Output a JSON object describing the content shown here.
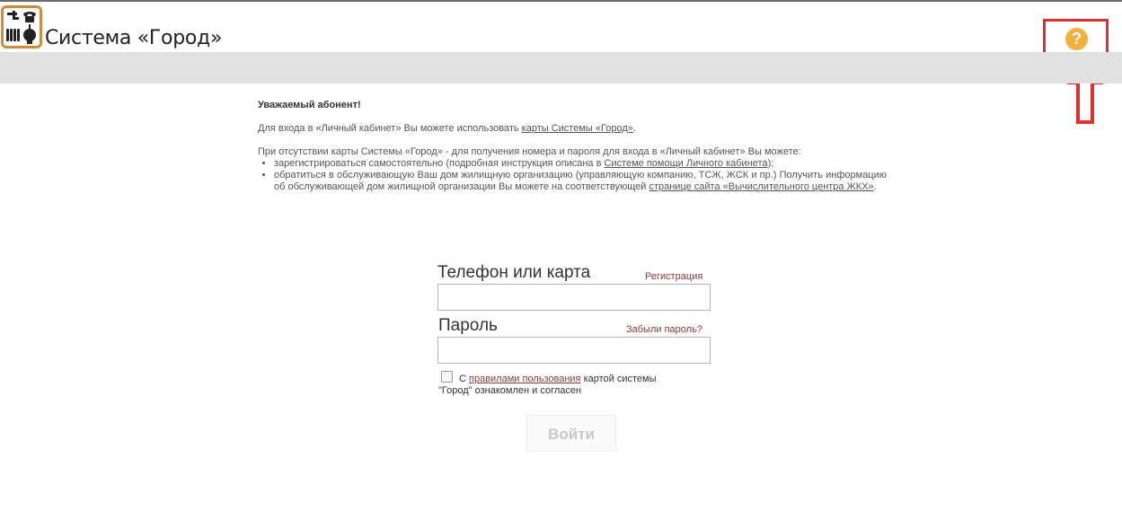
{
  "header": {
    "brand": "Система «Город»",
    "help_label": "?",
    "accent": "#d08a3a",
    "help_color": "#f3b03e",
    "highlight_color": "#e12f2f"
  },
  "intro": {
    "heading": "Уважаемый абонент!",
    "p1_text": "Для входа в «Личный кабинет» Вы можете использовать ",
    "p1_link": "карты Системы «Город»",
    "p1_end": ".",
    "p2": "При отсутствии карты Системы «Город» - для получения номера и пароля для входа в «Личный кабинет» Вы можете:",
    "li1_text": "зарегистрироваться самостоятельно (подробная инструкция описана в ",
    "li1_link": "Системе помощи Личного кабинета",
    "li1_end": ");",
    "li2_text": "обратиться в обслуживающую Ваш дом жилищную организацию (управляющую компанию, ТСЖ, ЖСК и пр.) Получить информацию об обслуживающей дом жилищной организации Вы можете на соответствующей ",
    "li2_link": "странице сайта «Вычислительного центра ЖКХ»",
    "li2_end": "."
  },
  "form": {
    "phone_label": "Телефон или карта",
    "register_link": "Регистрация",
    "phone_value": "",
    "password_label": "Пароль",
    "forgot_link": "Забыли пароль?",
    "password_value": "",
    "agree_prefix": "С ",
    "agree_link": "правилами пользования",
    "agree_suffix": " картой системы",
    "agree_line2": "\"Город\" ознакомлен и согласен",
    "agree_checked": false,
    "login_label": "Войти"
  }
}
